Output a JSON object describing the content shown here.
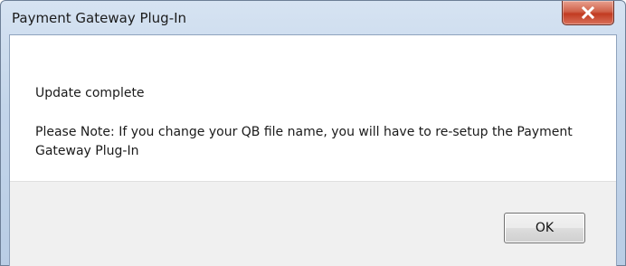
{
  "window": {
    "title": "Payment Gateway Plug-In",
    "close_icon": "close-icon"
  },
  "message": {
    "heading": "Update complete",
    "note": "Please Note:  If you change your QB file name, you will have to re-setup the Payment Gateway Plug-In"
  },
  "buttons": {
    "ok_label": "OK"
  },
  "colors": {
    "close_button": "#c23b21",
    "titlebar": "#c3d5ea",
    "button_area": "#f0f0f0"
  }
}
